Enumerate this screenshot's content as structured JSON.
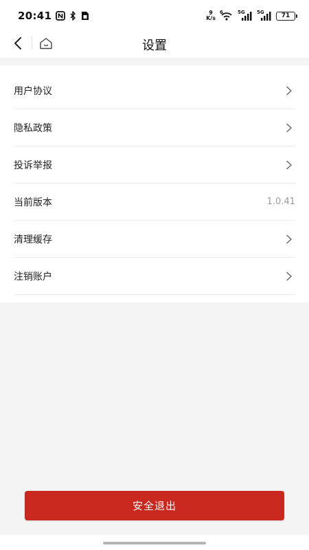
{
  "status_bar": {
    "time": "20:41",
    "speed_value": "9",
    "speed_unit": "K/s",
    "wifi_label": "6",
    "sim1_label": "5G",
    "sim2_label": "5G",
    "battery": "71"
  },
  "nav": {
    "title": "设置"
  },
  "settings": {
    "items": [
      {
        "label": "用户协议",
        "value": "",
        "has_arrow": true
      },
      {
        "label": "隐私政策",
        "value": "",
        "has_arrow": true
      },
      {
        "label": "投诉举报",
        "value": "",
        "has_arrow": true
      },
      {
        "label": "当前版本",
        "value": "1.0.41",
        "has_arrow": false
      },
      {
        "label": "清理缓存",
        "value": "",
        "has_arrow": true
      },
      {
        "label": "注销账户",
        "value": "",
        "has_arrow": true
      }
    ]
  },
  "actions": {
    "logout_label": "安全退出"
  },
  "colors": {
    "accent": "#c8281e",
    "background": "#f4f4f5",
    "card": "#ffffff",
    "muted_text": "#999999"
  },
  "icons": {
    "back": "chevron-left-icon",
    "home": "home-icon",
    "row_arrow": "chevron-right-icon"
  }
}
